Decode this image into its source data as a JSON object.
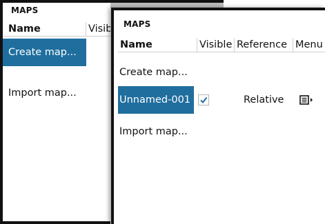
{
  "back_panel": {
    "title": "MAPS",
    "columns": [
      "Name",
      "Visib"
    ],
    "items": [
      {
        "label": "Create map...",
        "selected": true
      },
      {
        "label": "Import map...",
        "selected": false
      }
    ]
  },
  "front_panel": {
    "title": "MAPS",
    "columns": [
      "Name",
      "Visible",
      "Reference",
      "Menu"
    ],
    "create_label": "Create map...",
    "map_row": {
      "name": "Unnamed-001",
      "visible": true,
      "reference": "Relative",
      "menu_icon": "menu-list-icon"
    },
    "import_label": "Import map..."
  },
  "colors": {
    "selection": "#1f6e9e",
    "check": "#1f6e9e",
    "frame": "#111111"
  }
}
